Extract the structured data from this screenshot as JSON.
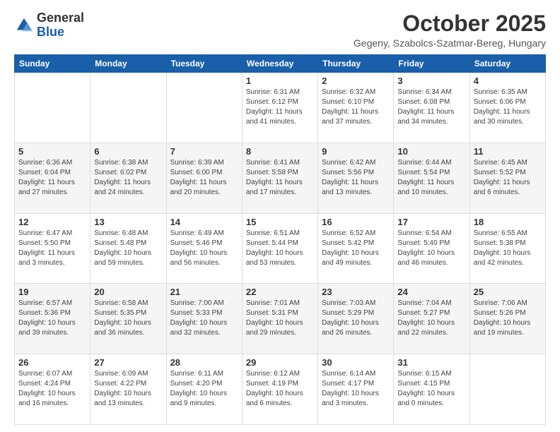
{
  "header": {
    "logo_general": "General",
    "logo_blue": "Blue",
    "month_title": "October 2025",
    "location": "Gegeny, Szabolcs-Szatmar-Bereg, Hungary"
  },
  "days_of_week": [
    "Sunday",
    "Monday",
    "Tuesday",
    "Wednesday",
    "Thursday",
    "Friday",
    "Saturday"
  ],
  "weeks": [
    [
      {
        "day": "",
        "info": ""
      },
      {
        "day": "",
        "info": ""
      },
      {
        "day": "",
        "info": ""
      },
      {
        "day": "1",
        "info": "Sunrise: 6:31 AM\nSunset: 6:12 PM\nDaylight: 11 hours\nand 41 minutes."
      },
      {
        "day": "2",
        "info": "Sunrise: 6:32 AM\nSunset: 6:10 PM\nDaylight: 11 hours\nand 37 minutes."
      },
      {
        "day": "3",
        "info": "Sunrise: 6:34 AM\nSunset: 6:08 PM\nDaylight: 11 hours\nand 34 minutes."
      },
      {
        "day": "4",
        "info": "Sunrise: 6:35 AM\nSunset: 6:06 PM\nDaylight: 11 hours\nand 30 minutes."
      }
    ],
    [
      {
        "day": "5",
        "info": "Sunrise: 6:36 AM\nSunset: 6:04 PM\nDaylight: 11 hours\nand 27 minutes."
      },
      {
        "day": "6",
        "info": "Sunrise: 6:38 AM\nSunset: 6:02 PM\nDaylight: 11 hours\nand 24 minutes."
      },
      {
        "day": "7",
        "info": "Sunrise: 6:39 AM\nSunset: 6:00 PM\nDaylight: 11 hours\nand 20 minutes."
      },
      {
        "day": "8",
        "info": "Sunrise: 6:41 AM\nSunset: 5:58 PM\nDaylight: 11 hours\nand 17 minutes."
      },
      {
        "day": "9",
        "info": "Sunrise: 6:42 AM\nSunset: 5:56 PM\nDaylight: 11 hours\nand 13 minutes."
      },
      {
        "day": "10",
        "info": "Sunrise: 6:44 AM\nSunset: 5:54 PM\nDaylight: 11 hours\nand 10 minutes."
      },
      {
        "day": "11",
        "info": "Sunrise: 6:45 AM\nSunset: 5:52 PM\nDaylight: 11 hours\nand 6 minutes."
      }
    ],
    [
      {
        "day": "12",
        "info": "Sunrise: 6:47 AM\nSunset: 5:50 PM\nDaylight: 11 hours\nand 3 minutes."
      },
      {
        "day": "13",
        "info": "Sunrise: 6:48 AM\nSunset: 5:48 PM\nDaylight: 10 hours\nand 59 minutes."
      },
      {
        "day": "14",
        "info": "Sunrise: 6:49 AM\nSunset: 5:46 PM\nDaylight: 10 hours\nand 56 minutes."
      },
      {
        "day": "15",
        "info": "Sunrise: 6:51 AM\nSunset: 5:44 PM\nDaylight: 10 hours\nand 53 minutes."
      },
      {
        "day": "16",
        "info": "Sunrise: 6:52 AM\nSunset: 5:42 PM\nDaylight: 10 hours\nand 49 minutes."
      },
      {
        "day": "17",
        "info": "Sunrise: 6:54 AM\nSunset: 5:40 PM\nDaylight: 10 hours\nand 46 minutes."
      },
      {
        "day": "18",
        "info": "Sunrise: 6:55 AM\nSunset: 5:38 PM\nDaylight: 10 hours\nand 42 minutes."
      }
    ],
    [
      {
        "day": "19",
        "info": "Sunrise: 6:57 AM\nSunset: 5:36 PM\nDaylight: 10 hours\nand 39 minutes."
      },
      {
        "day": "20",
        "info": "Sunrise: 6:58 AM\nSunset: 5:35 PM\nDaylight: 10 hours\nand 36 minutes."
      },
      {
        "day": "21",
        "info": "Sunrise: 7:00 AM\nSunset: 5:33 PM\nDaylight: 10 hours\nand 32 minutes."
      },
      {
        "day": "22",
        "info": "Sunrise: 7:01 AM\nSunset: 5:31 PM\nDaylight: 10 hours\nand 29 minutes."
      },
      {
        "day": "23",
        "info": "Sunrise: 7:03 AM\nSunset: 5:29 PM\nDaylight: 10 hours\nand 26 minutes."
      },
      {
        "day": "24",
        "info": "Sunrise: 7:04 AM\nSunset: 5:27 PM\nDaylight: 10 hours\nand 22 minutes."
      },
      {
        "day": "25",
        "info": "Sunrise: 7:06 AM\nSunset: 5:26 PM\nDaylight: 10 hours\nand 19 minutes."
      }
    ],
    [
      {
        "day": "26",
        "info": "Sunrise: 6:07 AM\nSunset: 4:24 PM\nDaylight: 10 hours\nand 16 minutes."
      },
      {
        "day": "27",
        "info": "Sunrise: 6:09 AM\nSunset: 4:22 PM\nDaylight: 10 hours\nand 13 minutes."
      },
      {
        "day": "28",
        "info": "Sunrise: 6:11 AM\nSunset: 4:20 PM\nDaylight: 10 hours\nand 9 minutes."
      },
      {
        "day": "29",
        "info": "Sunrise: 6:12 AM\nSunset: 4:19 PM\nDaylight: 10 hours\nand 6 minutes."
      },
      {
        "day": "30",
        "info": "Sunrise: 6:14 AM\nSunset: 4:17 PM\nDaylight: 10 hours\nand 3 minutes."
      },
      {
        "day": "31",
        "info": "Sunrise: 6:15 AM\nSunset: 4:15 PM\nDaylight: 10 hours\nand 0 minutes."
      },
      {
        "day": "",
        "info": ""
      }
    ]
  ]
}
